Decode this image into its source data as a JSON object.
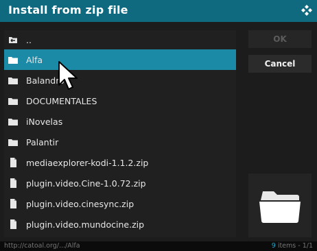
{
  "window": {
    "title": "Install from zip file",
    "logo_icon": "kodi-logo-icon"
  },
  "list": {
    "items": [
      {
        "label": "..",
        "icon": "parent-folder-icon"
      },
      {
        "label": "Alfa",
        "icon": "folder-icon",
        "selected": true
      },
      {
        "label": "Balandro",
        "icon": "folder-icon"
      },
      {
        "label": "DOCUMENTALES",
        "icon": "folder-icon"
      },
      {
        "label": "iNovelas",
        "icon": "folder-icon"
      },
      {
        "label": "Palantir",
        "icon": "folder-icon"
      },
      {
        "label": "mediaexplorer-kodi-1.1.2.zip",
        "icon": "file-icon"
      },
      {
        "label": "plugin.video.Cine-1.0.72.zip",
        "icon": "file-icon"
      },
      {
        "label": "plugin.video.cinesync.zip",
        "icon": "file-icon"
      },
      {
        "label": "plugin.video.mundocine.zip",
        "icon": "file-icon"
      }
    ]
  },
  "buttons": {
    "ok": "OK",
    "cancel": "Cancel"
  },
  "preview": {
    "icon": "large-folder-icon"
  },
  "footer": {
    "path": "http://catoal.org/.../Alfa",
    "count_number": "9",
    "count_rest": " items - 1/1"
  },
  "colors": {
    "title_bar": "#0f6a80",
    "selected_row": "#1a8aa6",
    "accent_text": "#1aa6c7"
  }
}
